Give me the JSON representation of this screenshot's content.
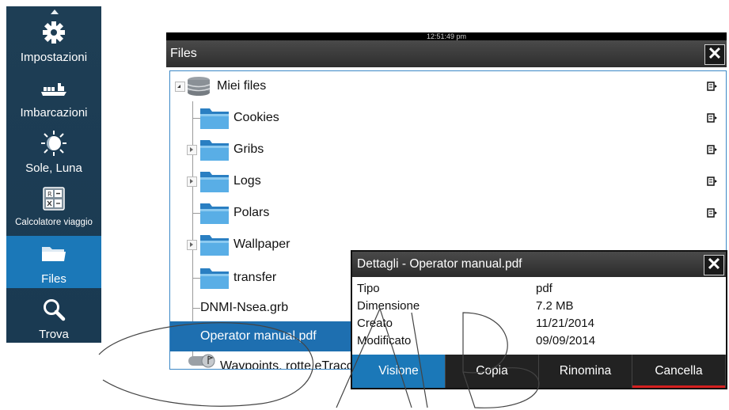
{
  "sidebar": {
    "items": [
      {
        "label": "Impostazioni",
        "icon": "gear-icon"
      },
      {
        "label": "Imbarcazioni",
        "icon": "vessel-icon"
      },
      {
        "label": "Sole, Luna",
        "icon": "sun-moon-icon"
      },
      {
        "label": "Calcolatore viaggio",
        "icon": "calculator-icon"
      },
      {
        "label": "Files",
        "icon": "folder-icon",
        "active": true
      },
      {
        "label": "Trova",
        "icon": "search-icon"
      }
    ]
  },
  "window": {
    "clock": "12:51:49 pm",
    "title": "Files",
    "tree": [
      {
        "label": "Miei files",
        "type": "storage",
        "expander": "open"
      },
      {
        "label": "Cookies",
        "type": "folder"
      },
      {
        "label": "Gribs",
        "type": "folder",
        "expander": "closed"
      },
      {
        "label": "Logs",
        "type": "folder",
        "expander": "closed"
      },
      {
        "label": "Polars",
        "type": "folder"
      },
      {
        "label": "Wallpaper",
        "type": "folder",
        "expander": "closed"
      },
      {
        "label": "transfer",
        "type": "folder"
      },
      {
        "label": "DNMI-Nsea.grb",
        "type": "file"
      },
      {
        "label": "Operator manual.pdf",
        "type": "file",
        "selected": true
      },
      {
        "label": "Waypoints, rotte eTracce",
        "type": "database"
      }
    ]
  },
  "details": {
    "title": "Dettagli - Operator manual.pdf",
    "properties": [
      {
        "name": "Tipo",
        "value": "pdf"
      },
      {
        "name": "Dimensione",
        "value": "7.2 MB"
      },
      {
        "name": "Creato",
        "value": "11/21/2014"
      },
      {
        "name": "Modificato",
        "value": "09/09/2014"
      }
    ],
    "actions": [
      "Visione",
      "Copia",
      "Rinomina",
      "Cancella"
    ]
  },
  "colors": {
    "sidebar_bg": "#1e3e55",
    "accent": "#1b78b8",
    "selection": "#1e6fb0",
    "danger": "#d42020"
  }
}
